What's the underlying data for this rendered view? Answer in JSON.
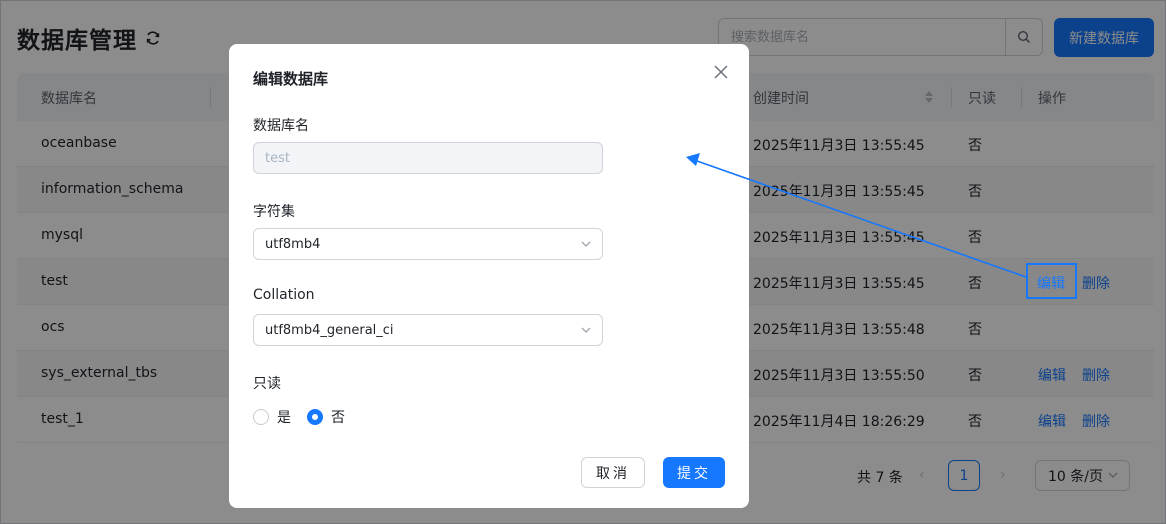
{
  "header": {
    "title": "数据库管理",
    "search_placeholder": "搜索数据库名",
    "new_button": "新建数据库"
  },
  "table": {
    "columns": [
      "数据库名",
      "创建时间",
      "只读",
      "操作"
    ],
    "rows": [
      {
        "name": "oceanbase",
        "created": "2025年11月3日 13:55:45",
        "readonly": "否",
        "edit": "",
        "delete": ""
      },
      {
        "name": "information_schema",
        "created": "2025年11月3日 13:55:45",
        "readonly": "否",
        "edit": "",
        "delete": ""
      },
      {
        "name": "mysql",
        "created": "2025年11月3日 13:55:45",
        "readonly": "否",
        "edit": "",
        "delete": ""
      },
      {
        "name": "test",
        "created": "2025年11月3日 13:55:45",
        "readonly": "否",
        "edit": "编辑",
        "delete": "删除"
      },
      {
        "name": "ocs",
        "created": "2025年11月3日 13:55:48",
        "readonly": "否",
        "edit": "",
        "delete": ""
      },
      {
        "name": "sys_external_tbs",
        "created": "2025年11月3日 13:55:50",
        "readonly": "否",
        "edit": "编辑",
        "delete": "删除"
      },
      {
        "name": "test_1",
        "created": "2025年11月4日 18:26:29",
        "readonly": "否",
        "edit": "编辑",
        "delete": "删除"
      }
    ]
  },
  "pagination": {
    "total": "共 7 条",
    "current": "1",
    "page_size": "10 条/页"
  },
  "modal": {
    "title": "编辑数据库",
    "name_label": "数据库名",
    "name_value": "test",
    "charset_label": "字符集",
    "charset_value": "utf8mb4",
    "collation_label": "Collation",
    "collation_value": "utf8mb4_general_ci",
    "readonly_label": "只读",
    "option_yes": "是",
    "option_no": "否",
    "cancel": "取消",
    "submit": "提交"
  },
  "annotation": {
    "highlight_label": "编辑"
  },
  "colors": {
    "accent": "#1677ff",
    "mask": "rgba(0,0,0,0.45)"
  }
}
